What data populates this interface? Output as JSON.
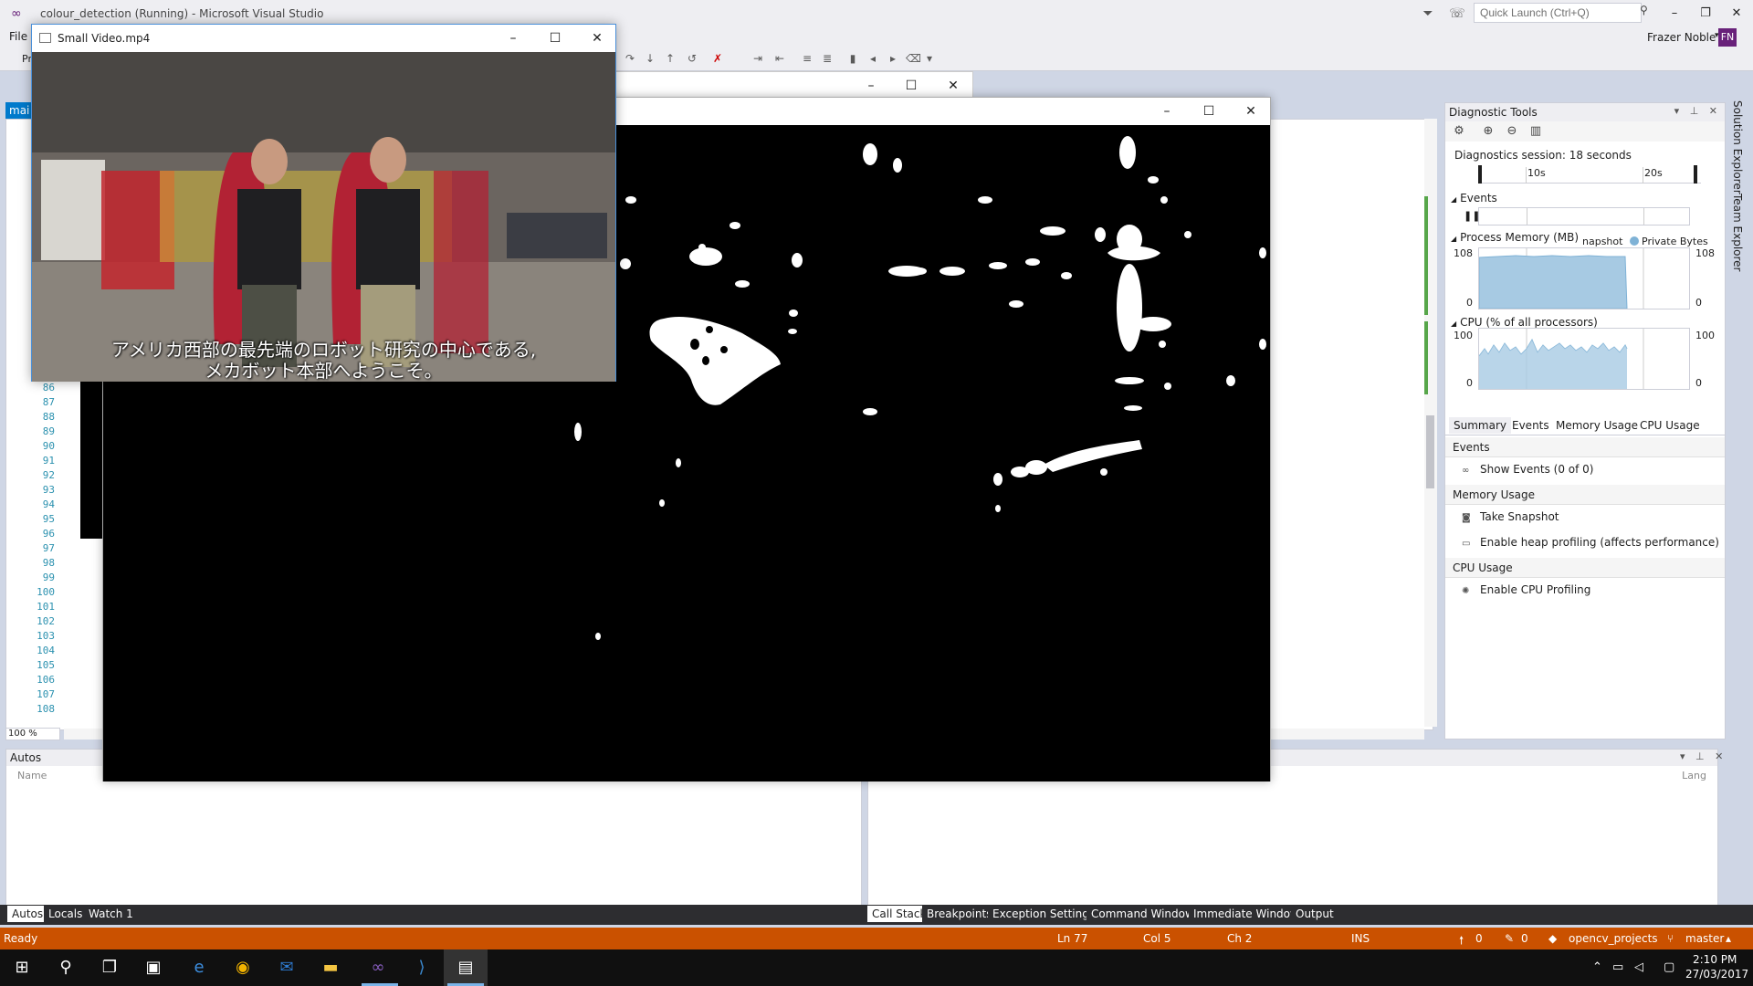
{
  "vs": {
    "title": "colour_detection (Running) - Microsoft Visual Studio",
    "quick_launch_placeholder": "Quick Launch (Ctrl+Q)",
    "menu_file": "File",
    "user_name": "Frazer Noble",
    "user_initials": "FN",
    "toolbar_fragment": "Pr",
    "editor_tab": "mai",
    "zoom": "100 %",
    "line_numbers": [
      "86",
      "87",
      "88",
      "89",
      "90",
      "91",
      "92",
      "93",
      "94",
      "95",
      "96",
      "97",
      "98",
      "99",
      "100",
      "101",
      "102",
      "103",
      "104",
      "105",
      "106",
      "107",
      "108"
    ]
  },
  "video_window": {
    "title": "Small Video.mp4",
    "subtitle_line1": "アメリカ西部の最先端のロボット研究の中心である,",
    "subtitle_line2": "メカボット本部へようこそ。"
  },
  "diagnostics": {
    "title": "Diagnostic Tools",
    "session": "Diagnostics session: 18 seconds",
    "timeline_ticks": [
      "10s",
      "20s"
    ],
    "events_label": "Events",
    "memory_label": "Process Memory (MB)",
    "memory_legend_snapshot": "napshot",
    "memory_legend_private": "Private Bytes",
    "memory_max": "108",
    "memory_min": "0",
    "cpu_label": "CPU (% of all processors)",
    "cpu_max": "100",
    "cpu_min": "0",
    "tabs": [
      "Summary",
      "Events",
      "Memory Usage",
      "CPU Usage"
    ],
    "group_events": "Events",
    "show_events": "Show Events (0 of 0)",
    "group_memory": "Memory Usage",
    "take_snapshot": "Take Snapshot",
    "enable_heap": "Enable heap profiling (affects performance)",
    "group_cpu": "CPU Usage",
    "enable_cpu": "Enable CPU Profiling"
  },
  "side_tabs": [
    "Solution Explorer",
    "Team Explorer"
  ],
  "autos": {
    "title": "Autos",
    "column_name": "Name",
    "tabs": [
      "Autos",
      "Locals",
      "Watch 1"
    ]
  },
  "callstack": {
    "column_lang": "Lang",
    "tabs": [
      "Call Stack",
      "Breakpoints",
      "Exception Settings",
      "Command Window",
      "Immediate Window",
      "Output"
    ]
  },
  "status": {
    "ready": "Ready",
    "ln": "Ln 77",
    "col": "Col 5",
    "ch": "Ch 2",
    "ins": "INS",
    "up_count": "0",
    "pencil_count": "0",
    "project": "opencv_projects",
    "branch": "master"
  },
  "taskbar": {
    "time": "2:10 PM",
    "date": "27/03/2017"
  },
  "colors": {
    "status_bar": "#ca5100",
    "accent": "#007acc",
    "vs_purple": "#68217a"
  }
}
